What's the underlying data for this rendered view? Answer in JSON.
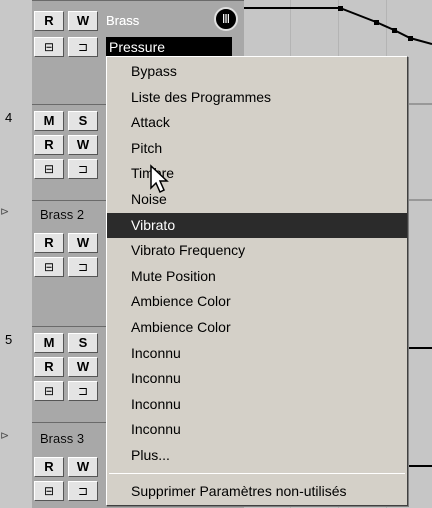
{
  "tracks": [
    {
      "name": "Brass",
      "parameter_field": "Pressure",
      "buttons": {
        "read": "R",
        "write": "W"
      },
      "automation_button": "Ⅲ"
    },
    {
      "number": "4",
      "buttons": {
        "mute": "M",
        "solo": "S",
        "read": "R",
        "write": "W"
      }
    },
    {
      "name": "Brass 2",
      "buttons": {
        "read": "R",
        "write": "W"
      }
    },
    {
      "number": "5",
      "buttons": {
        "mute": "M",
        "solo": "S",
        "read": "R",
        "write": "W"
      }
    },
    {
      "name": "Brass 3",
      "buttons": {
        "read": "R",
        "write": "W"
      }
    }
  ],
  "context_menu": {
    "items": [
      {
        "label": "Bypass"
      },
      {
        "label": "Liste des Programmes"
      },
      {
        "label": "Attack"
      },
      {
        "label": "Pitch"
      },
      {
        "label": "Timbre"
      },
      {
        "label": "Noise"
      },
      {
        "label": "Vibrato",
        "highlighted": true
      },
      {
        "label": "Vibrato Frequency"
      },
      {
        "label": "Mute Position"
      },
      {
        "label": "Ambience Color"
      },
      {
        "label": "Ambience Color"
      },
      {
        "label": "Inconnu"
      },
      {
        "label": "Inconnu"
      },
      {
        "label": "Inconnu"
      },
      {
        "label": "Inconnu"
      },
      {
        "label": "Plus..."
      }
    ],
    "footer_item": "Supprimer Paramètres non-utilisés"
  },
  "icons": {
    "monitor": "monitor-icon",
    "lock": "lock-icon",
    "automation": "automation-icon",
    "fold": "fold-arrow-icon",
    "cursor": "mouse-cursor-icon"
  },
  "colors": {
    "menu_background": "#d4d0c8",
    "highlight": "#2b2b2b",
    "parameter_field": "#000000"
  }
}
